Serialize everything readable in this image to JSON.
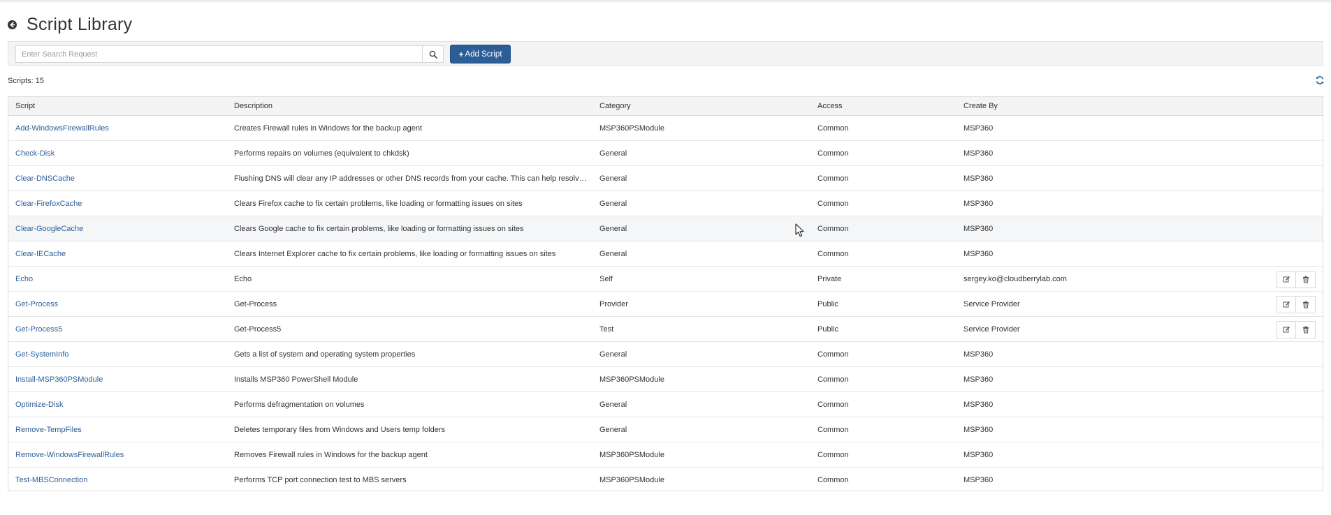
{
  "header": {
    "title": "Script Library"
  },
  "toolbar": {
    "search_placeholder": "Enter Search Request",
    "add_plus": "+",
    "add_label": "Add Script"
  },
  "summary": {
    "scripts_count_text": "Scripts: 15"
  },
  "table": {
    "columns": [
      "Script",
      "Description",
      "Category",
      "Access",
      "Create By"
    ],
    "rows": [
      {
        "script": "Add-WindowsFirewallRules",
        "description": "Creates Firewall rules in Windows for the backup agent",
        "category": "MSP360PSModule",
        "access": "Common",
        "created_by": "MSP360",
        "editable": false
      },
      {
        "script": "Check-Disk",
        "description": "Performs repairs on volumes (equivalent to chkdsk)",
        "category": "General",
        "access": "Common",
        "created_by": "MSP360",
        "editable": false
      },
      {
        "script": "Clear-DNSCache",
        "description": "Flushing DNS will clear any IP addresses or other DNS records from your cache. This can help resolve security, internet connectivity, and other issues",
        "category": "General",
        "access": "Common",
        "created_by": "MSP360",
        "editable": false
      },
      {
        "script": "Clear-FirefoxCache",
        "description": "Clears Firefox cache to fix certain problems, like loading or formatting issues on sites",
        "category": "General",
        "access": "Common",
        "created_by": "MSP360",
        "editable": false
      },
      {
        "script": "Clear-GoogleCache",
        "description": "Clears Google cache to fix certain problems, like loading or formatting issues on sites",
        "category": "General",
        "access": "Common",
        "created_by": "MSP360",
        "editable": false
      },
      {
        "script": "Clear-IECache",
        "description": "Clears Internet Explorer cache to fix certain problems, like loading or formatting issues on sites",
        "category": "General",
        "access": "Common",
        "created_by": "MSP360",
        "editable": false
      },
      {
        "script": "Echo",
        "description": "Echo",
        "category": "Self",
        "access": "Private",
        "created_by": "sergey.ko@cloudberrylab.com",
        "editable": true
      },
      {
        "script": "Get-Process",
        "description": "Get-Process",
        "category": "Provider",
        "access": "Public",
        "created_by": "Service Provider",
        "editable": true
      },
      {
        "script": "Get-Process5",
        "description": "Get-Process5",
        "category": "Test",
        "access": "Public",
        "created_by": "Service Provider",
        "editable": true
      },
      {
        "script": "Get-SystemInfo",
        "description": "Gets a list of system and operating system properties",
        "category": "General",
        "access": "Common",
        "created_by": "MSP360",
        "editable": false
      },
      {
        "script": "Install-MSP360PSModule",
        "description": "Installs MSP360 PowerShell Module",
        "category": "MSP360PSModule",
        "access": "Common",
        "created_by": "MSP360",
        "editable": false
      },
      {
        "script": "Optimize-Disk",
        "description": "Performs defragmentation on volumes",
        "category": "General",
        "access": "Common",
        "created_by": "MSP360",
        "editable": false
      },
      {
        "script": "Remove-TempFiles",
        "description": "Deletes temporary files from Windows and Users temp folders",
        "category": "General",
        "access": "Common",
        "created_by": "MSP360",
        "editable": false
      },
      {
        "script": "Remove-WindowsFirewallRules",
        "description": "Removes Firewall rules in Windows for the backup agent",
        "category": "MSP360PSModule",
        "access": "Common",
        "created_by": "MSP360",
        "editable": false
      },
      {
        "script": "Test-MBSConnection",
        "description": "Performs TCP port connection test to MBS servers",
        "category": "MSP360PSModule",
        "access": "Common",
        "created_by": "MSP360",
        "editable": false
      }
    ],
    "hovered_row_index": 4
  },
  "icons": {
    "back": "arrow-circle-left-icon",
    "search": "search-icon",
    "refresh": "refresh-icon",
    "edit": "edit-icon",
    "delete": "trash-icon",
    "cursor": "mouse-pointer"
  },
  "colors": {
    "accent": "#2b5d96",
    "link": "#2d5f99",
    "header_bg": "#f4f4f4",
    "border": "#dcdcdc"
  }
}
